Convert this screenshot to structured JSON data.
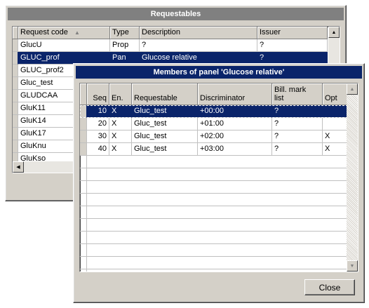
{
  "requestables_window": {
    "title": "Requestables",
    "columns": [
      "Request code",
      "Type",
      "Description",
      "Issuer"
    ],
    "rows": [
      {
        "code": "GlucU",
        "type": "Prop",
        "description": "?",
        "issuer": "?"
      },
      {
        "code": "GLUC_prof",
        "type": "Pan",
        "description": "Glucose relative",
        "issuer": "?"
      },
      {
        "code": "GLUC_prof2",
        "type": "",
        "description": "",
        "issuer": ""
      },
      {
        "code": "Gluc_test",
        "type": "",
        "description": "",
        "issuer": ""
      },
      {
        "code": "GLUDCAA",
        "type": "",
        "description": "",
        "issuer": ""
      },
      {
        "code": "GluK11",
        "type": "",
        "description": "",
        "issuer": ""
      },
      {
        "code": "GluK14",
        "type": "",
        "description": "",
        "issuer": ""
      },
      {
        "code": "GluK17",
        "type": "",
        "description": "",
        "issuer": ""
      },
      {
        "code": "GluKnu",
        "type": "",
        "description": "",
        "issuer": ""
      },
      {
        "code": "GluKso",
        "type": "",
        "description": "",
        "issuer": ""
      }
    ],
    "sort_indicator": "▲"
  },
  "members_window": {
    "title": "Members of panel 'Glucose relative'",
    "columns": {
      "seq": "Seq",
      "en": "En.",
      "requestable": "Requestable",
      "discriminator": "Discriminator",
      "bill_line1": "Bill. mark",
      "bill_line2": "list",
      "opt": "Opt"
    },
    "rows": [
      {
        "seq": "10",
        "en": "X",
        "requestable": "Gluc_test",
        "discriminator": "+00:00",
        "bill": "?",
        "opt": ""
      },
      {
        "seq": "20",
        "en": "X",
        "requestable": "Gluc_test",
        "discriminator": "+01:00",
        "bill": "?",
        "opt": ""
      },
      {
        "seq": "30",
        "en": "X",
        "requestable": "Gluc_test",
        "discriminator": "+02:00",
        "bill": "?",
        "opt": "X"
      },
      {
        "seq": "40",
        "en": "X",
        "requestable": "Gluc_test",
        "discriminator": "+03:00",
        "bill": "?",
        "opt": "X"
      }
    ],
    "close_label": "Close"
  },
  "colors": {
    "titlebar_inactive": "#808080",
    "titlebar_active": "#0a246a",
    "selection": "#0a246a"
  }
}
